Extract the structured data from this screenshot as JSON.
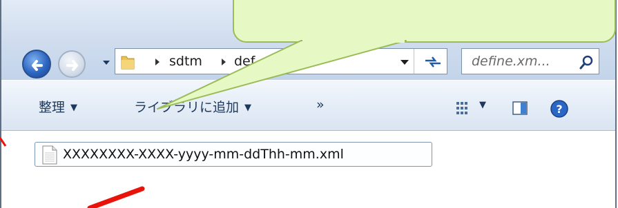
{
  "address_bar": {
    "breadcrumbs": [
      "sdtm",
      "def"
    ]
  },
  "search": {
    "placeholder": "define.xm..."
  },
  "toolbar": {
    "organize_label": "整理",
    "add_to_library_label": "ライブラリに追加",
    "more_label": "»"
  },
  "file_list": [
    {
      "name": "XXXXXXXX-XXXX-yyyy-mm-ddThh-mm.xml"
    }
  ],
  "callout": {
    "fill_color": "#e6f8c4",
    "border_color": "#9bbb59"
  },
  "annotation": {
    "arrow_color": "#e8140c"
  }
}
